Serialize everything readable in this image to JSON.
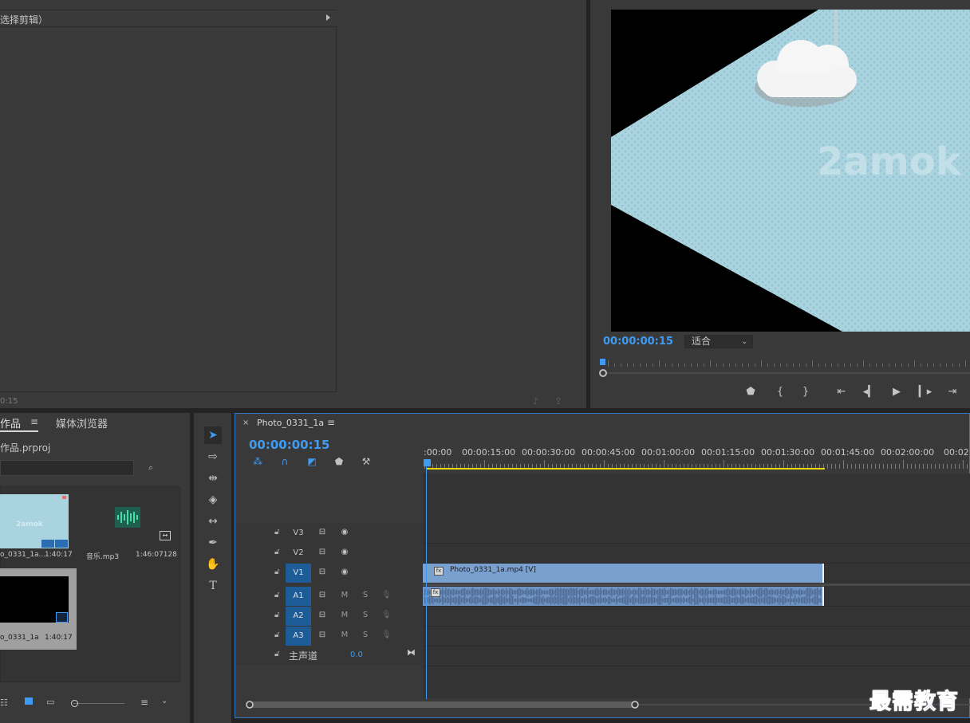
{
  "source_panel": {
    "header_label": "选择剪辑）",
    "timecode": "0:15"
  },
  "program_monitor": {
    "timecode": "00:00:00:15",
    "fit_label": "适合",
    "watermark_text": "2amok",
    "transport_icons": [
      "marker-icon",
      "in-point-icon",
      "out-point-icon",
      "go-to-in-icon",
      "step-back-icon",
      "play-icon",
      "step-forward-icon",
      "go-to-out-icon"
    ]
  },
  "project_panel": {
    "tab_label": "作品",
    "menu_glyph": "≡",
    "media_browser_tab": "媒体浏览器",
    "project_file": "作品.prproj",
    "items": [
      {
        "name": "o_0331_1a...",
        "duration": "1:40:17"
      },
      {
        "name": "音乐.mp3",
        "duration": "1:46:07128"
      },
      {
        "name": "o_0331_1a",
        "duration": "1:40:17"
      }
    ],
    "thumb_text": "2amok"
  },
  "timeline": {
    "sequence_name": "Photo_0331_1a",
    "menu_glyph": "≡",
    "timecode": "00:00:00:15",
    "ruler_labels": [
      ":00:00",
      "00:00:15:00",
      "00:00:30:00",
      "00:00:45:00",
      "00:01:00:00",
      "00:01:15:00",
      "00:01:30:00",
      "00:01:45:00",
      "00:02:00:00",
      "00:02:1"
    ],
    "video_tracks": [
      {
        "name": "V3",
        "active": false
      },
      {
        "name": "V2",
        "active": false
      },
      {
        "name": "V1",
        "active": true
      }
    ],
    "audio_tracks": [
      {
        "name": "A1",
        "mute": "M",
        "solo": "S"
      },
      {
        "name": "A2",
        "mute": "M",
        "solo": "S"
      },
      {
        "name": "A3",
        "mute": "M",
        "solo": "S"
      }
    ],
    "master_label": "主声道",
    "master_value": "0.0",
    "video_clip_name": "Photo_0331_1a.mp4 [V]",
    "fx_badge": "fx"
  },
  "watermark": "最需教育",
  "colors": {
    "accent_blue": "#3e9bf3",
    "work_area_yellow": "#e8d800",
    "clip_video": "#7aa0cf",
    "clip_audio": "#6f93c3",
    "active_track": "#1d5c96"
  }
}
